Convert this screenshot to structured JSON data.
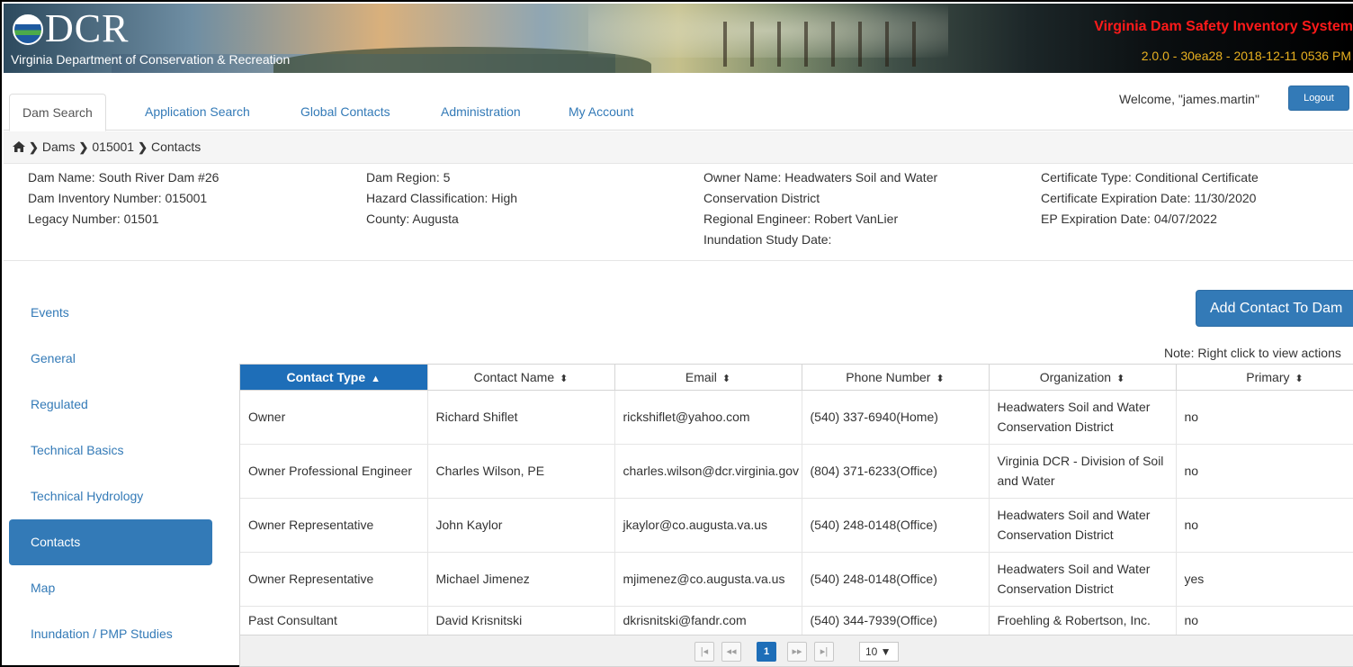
{
  "banner": {
    "logo_text": "DCR",
    "logo_subtitle": "Virginia Department of Conservation & Recreation",
    "system_title": "Virginia Dam Safety Inventory System",
    "version": "2.0.0 - 30ea28 - 2018-12-11 0536 PM",
    "colors": {
      "title": "#ff1a1a",
      "version": "#e8b020"
    }
  },
  "nav": {
    "tabs": [
      {
        "label": "Dam Search",
        "active": true
      },
      {
        "label": "Application Search",
        "active": false
      },
      {
        "label": "Global Contacts",
        "active": false
      },
      {
        "label": "Administration",
        "active": false
      },
      {
        "label": "My Account",
        "active": false
      }
    ],
    "welcome": "Welcome, \"james.martin\"",
    "logout": "Logout"
  },
  "breadcrumb": {
    "icon": "home-icon",
    "items": [
      "Dams",
      "015001",
      "Contacts"
    ]
  },
  "dam_info": {
    "col1": [
      {
        "label": "Dam Name:",
        "value": "South River Dam #26"
      },
      {
        "label": "Dam Inventory Number:",
        "value": "015001"
      },
      {
        "label": "Legacy Number:",
        "value": "01501"
      }
    ],
    "col2": [
      {
        "label": "Dam Region:",
        "value": "5"
      },
      {
        "label": "Hazard Classification:",
        "value": "High"
      },
      {
        "label": "County:",
        "value": "Augusta"
      }
    ],
    "col3": {
      "owner_label": "Owner Name:",
      "owner_value_line1": "Headwaters Soil and Water",
      "owner_value_line2": "Conservation District",
      "engineer_label": "Regional Engineer:",
      "engineer_value": "Robert VanLier",
      "inundation_label": "Inundation Study Date:",
      "inundation_value": ""
    },
    "col4": [
      {
        "label": "Certificate Type:",
        "value": "Conditional Certificate"
      },
      {
        "label": "Certificate Expiration Date:",
        "value": "11/30/2020"
      },
      {
        "label": "EP Expiration Date:",
        "value": "04/07/2022"
      }
    ]
  },
  "sidebar": {
    "items": [
      {
        "label": "Events",
        "active": false
      },
      {
        "label": "General",
        "active": false
      },
      {
        "label": "Regulated",
        "active": false
      },
      {
        "label": "Technical Basics",
        "active": false
      },
      {
        "label": "Technical Hydrology",
        "active": false
      },
      {
        "label": "Contacts",
        "active": true
      },
      {
        "label": "Map",
        "active": false
      },
      {
        "label": "Inundation / PMP Studies",
        "active": false
      }
    ]
  },
  "contacts": {
    "add_button": "Add Contact To Dam",
    "note": "Note: Right click to view actions",
    "columns": [
      "Contact Type",
      "Contact Name",
      "Email",
      "Phone Number",
      "Organization",
      "Primary"
    ],
    "sorted_column": "Contact Type",
    "rows": [
      {
        "type": "Owner",
        "name": "Richard Shiflet",
        "email": "rickshiflet@yahoo.com",
        "phone": "(540) 337-6940(Home)",
        "org": "Headwaters Soil and Water Conservation District",
        "primary": "no"
      },
      {
        "type": "Owner Professional Engineer",
        "name": "Charles Wilson, PE",
        "email": "charles.wilson@dcr.virginia.gov",
        "phone": "(804) 371-6233(Office)",
        "org": "Virginia DCR - Division of Soil and Water",
        "primary": "no"
      },
      {
        "type": "Owner Representative",
        "name": "John Kaylor",
        "email": "jkaylor@co.augusta.va.us",
        "phone": "(540) 248-0148(Office)",
        "org": "Headwaters Soil and Water Conservation District",
        "primary": "no"
      },
      {
        "type": "Owner Representative",
        "name": "Michael Jimenez",
        "email": "mjimenez@co.augusta.va.us",
        "phone": "(540) 248-0148(Office)",
        "org": "Headwaters Soil and Water Conservation District",
        "primary": "yes"
      },
      {
        "type": "Past Consultant",
        "name": "David Krisnitski",
        "email": "dkrisnitski@fandr.com",
        "phone": "(540) 344-7939(Office)",
        "org": "Froehling & Robertson, Inc.",
        "primary": "no"
      }
    ],
    "pager": {
      "current_page": "1",
      "page_size": "10 ▼"
    }
  }
}
